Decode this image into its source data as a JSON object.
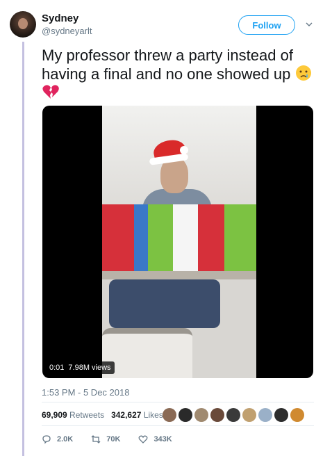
{
  "user": {
    "name": "Sydney",
    "handle": "@sydneyarlt"
  },
  "follow_label": "Follow",
  "tweet": {
    "text": "My professor threw a party instead of having a final and no one showed up",
    "emoji_1": "crying-face",
    "emoji_2": "broken-heart"
  },
  "video": {
    "time": "0:01",
    "views": "7.98M views"
  },
  "timestamp": "1:53 PM - 5 Dec 2018",
  "stats": {
    "retweets_count": "69,909",
    "retweets_label": "Retweets",
    "likes_count": "342,627",
    "likes_label": "Likes"
  },
  "likers": [
    "#8a6a55",
    "#2a2a2a",
    "#a08a70",
    "#6a4a3a",
    "#3a3a3a",
    "#c0a070",
    "#9ab0c8",
    "#2d2d2d",
    "#d08a30"
  ],
  "actions": {
    "reply_count": "2.0K",
    "retweet_count": "70K",
    "like_count": "343K"
  },
  "colors": {
    "accent": "#1da1f2",
    "thread_line": "#c4c0e0"
  }
}
